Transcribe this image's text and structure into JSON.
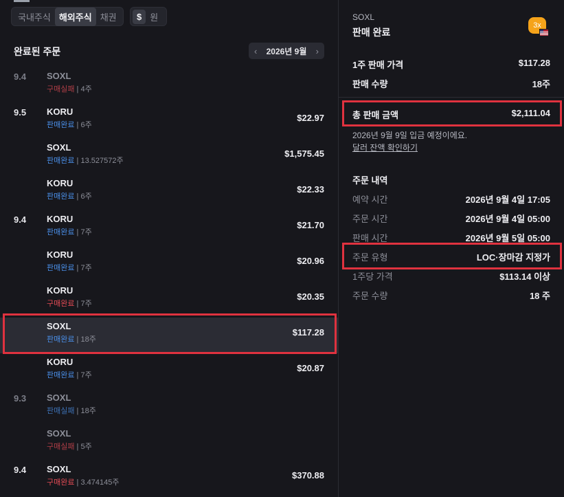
{
  "market_tabs": [
    "국내주식",
    "해외주식",
    "채권"
  ],
  "currency": {
    "dollar": "$",
    "won": "원"
  },
  "orders_section": {
    "title": "완료된 주문",
    "month": "2026년 9월"
  },
  "orders": [
    {
      "date": "9.4",
      "ticker": "SOXL",
      "status": "구매실패",
      "qty": " | 4주",
      "amount": ""
    },
    {
      "date": "9.5",
      "ticker": "KORU",
      "status": "판매완료",
      "qty": " | 6주",
      "amount": "$22.97"
    },
    {
      "date": "",
      "ticker": "SOXL",
      "status": "판매완료",
      "qty": " | 13.527572주",
      "amount": "$1,575.45"
    },
    {
      "date": "",
      "ticker": "KORU",
      "status": "판매완료",
      "qty": " | 6주",
      "amount": "$22.33"
    },
    {
      "date": "9.4",
      "ticker": "KORU",
      "status": "판매완료",
      "qty": " | 7주",
      "amount": "$21.70"
    },
    {
      "date": "",
      "ticker": "KORU",
      "status": "판매완료",
      "qty": " | 7주",
      "amount": "$20.96"
    },
    {
      "date": "",
      "ticker": "KORU",
      "status": "구매완료",
      "qty": " | 7주",
      "amount": "$20.35"
    },
    {
      "date": "",
      "ticker": "SOXL",
      "status": "판매완료",
      "qty": " | 18주",
      "amount": "$117.28"
    },
    {
      "date": "",
      "ticker": "KORU",
      "status": "판매완료",
      "qty": " | 7주",
      "amount": "$20.87"
    },
    {
      "date": "9.3",
      "ticker": "SOXL",
      "status": "판매실패",
      "qty": " | 18주",
      "amount": ""
    },
    {
      "date": "",
      "ticker": "SOXL",
      "status": "구매실패",
      "qty": " | 5주",
      "amount": ""
    },
    {
      "date": "9.4",
      "ticker": "SOXL",
      "status": "구매완료",
      "qty": " | 3.474145주",
      "amount": "$370.88"
    }
  ],
  "detail": {
    "ticker": "SOXL",
    "title": "판매 완료",
    "badge": "3x",
    "price_label": "1주 판매 가격",
    "price": "$117.28",
    "qty_label": "판매 수량",
    "qty": "18주",
    "total_label": "총 판매 금액",
    "total": "$2,111.04",
    "deposit_note": "2026년 9월 9일 입금 예정이에요.",
    "balance_link": "달러 잔액 확인하기",
    "order_details_title": "주문 내역",
    "reserved_label": "예약 시간",
    "reserved": "2026년 9월 4일 17:05",
    "order_time_label": "주문 시간",
    "order_time": "2026년 9월 4일 05:00",
    "sell_time_label": "판매 시간",
    "sell_time": "2026년 9월 5일 05:00",
    "order_type_label": "주문 유형",
    "order_type": "LOC·장마감 지정가",
    "per_share_label": "1주당 가격",
    "per_share": "$113.14 이상",
    "order_qty_label": "주문 수량",
    "order_qty": "18 주"
  },
  "colors": {
    "accent_red": "#e0323f",
    "sell_blue": "#4a8fe8",
    "buy_red": "#e34b55",
    "badge_orange": "#f5a31a"
  }
}
